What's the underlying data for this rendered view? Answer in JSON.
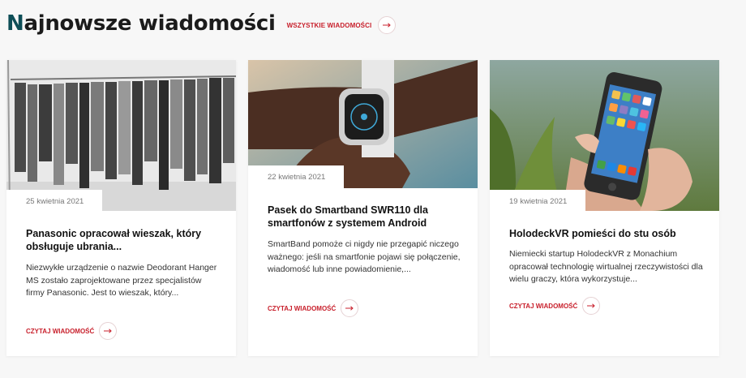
{
  "section": {
    "title_first": "N",
    "title_rest": "ajnowsze wiadomości",
    "all_news_label": "WSZYSTKIE WIADOMOŚCI"
  },
  "cards": [
    {
      "date": "25 kwietnia 2021",
      "title": "Panasonic opracował wieszak, który obsługuje ubrania...",
      "excerpt": "Niezwykłe urządzenie o nazwie Deodorant Hanger MS zostało zaprojektowane przez specjalistów firmy Panasonic. Jest to wieszak, który...",
      "read_more": "CZYTAJ WIADOMOŚĆ"
    },
    {
      "date": "22 kwietnia 2021",
      "title": "Pasek do Smartband SWR110 dla smartfonów z systemem Android",
      "excerpt": "SmartBand pomoże ci nigdy nie przegapić niczego ważnego: jeśli na smartfonie pojawi się połączenie, wiadomość lub inne powiadomienie,...",
      "read_more": "CZYTAJ WIADOMOŚĆ"
    },
    {
      "date": "19 kwietnia 2021",
      "title": "HolodeckVR pomieści do stu osób",
      "excerpt": "Niemiecki startup HolodeckVR z Monachium opracował technologię wirtualnej rzeczywistości dla wielu graczy, która wykorzystuje...",
      "read_more": "CZYTAJ WIADOMOŚĆ"
    }
  ],
  "colors": {
    "accent": "#c8202c",
    "title_initial": "#0e4e57",
    "background": "#f7f7f7"
  },
  "icons": {
    "arrow": "arrow-right-icon"
  }
}
